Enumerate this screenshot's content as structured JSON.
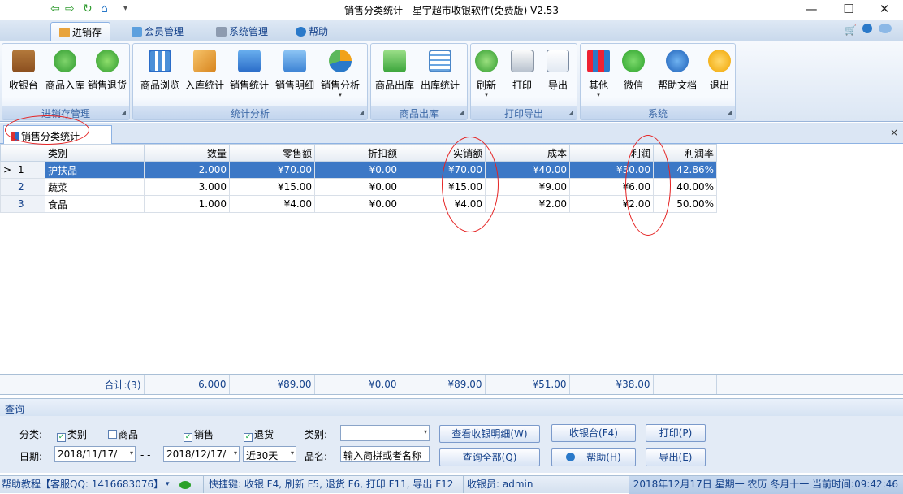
{
  "window": {
    "title": "销售分类统计 - 星宇超市收银软件(免费版) V2.53",
    "controls": {
      "minimize": "—",
      "maximize": "☐",
      "close": "✕"
    }
  },
  "ribbon_tabs": [
    "进销存",
    "会员管理",
    "系统管理",
    "帮助"
  ],
  "ribbon_groups": [
    {
      "label": "进销存管理",
      "buttons": [
        "收银台",
        "商品入库",
        "销售退货"
      ]
    },
    {
      "label": "统计分析",
      "buttons": [
        "商品浏览",
        "入库统计",
        "销售统计",
        "销售明细",
        "销售分析"
      ]
    },
    {
      "label": "商品出库",
      "buttons": [
        "商品出库",
        "出库统计"
      ]
    },
    {
      "label": "打印导出",
      "buttons": [
        "刷新",
        "打印",
        "导出"
      ]
    },
    {
      "label": "系统",
      "buttons": [
        "其他",
        "微信",
        "帮助文档",
        "退出"
      ]
    }
  ],
  "doc_tab": {
    "label": "销售分类统计",
    "close": "×"
  },
  "grid": {
    "columns": [
      "类别",
      "数量",
      "零售额",
      "折扣额",
      "实销额",
      "成本",
      "利润",
      "利润率"
    ],
    "rows": [
      {
        "idx": "1",
        "marker": ">",
        "cells": [
          "护扶品",
          "2.000",
          "¥70.00",
          "¥0.00",
          "¥70.00",
          "¥40.00",
          "¥30.00",
          "42.86%"
        ]
      },
      {
        "idx": "2",
        "marker": "",
        "cells": [
          "蔬菜",
          "3.000",
          "¥15.00",
          "¥0.00",
          "¥15.00",
          "¥9.00",
          "¥6.00",
          "40.00%"
        ]
      },
      {
        "idx": "3",
        "marker": "",
        "cells": [
          "食品",
          "1.000",
          "¥4.00",
          "¥0.00",
          "¥4.00",
          "¥2.00",
          "¥2.00",
          "50.00%"
        ]
      }
    ],
    "footer": [
      "合计:(3)",
      "6.000",
      "¥89.00",
      "¥0.00",
      "¥89.00",
      "¥51.00",
      "¥38.00",
      ""
    ]
  },
  "query": {
    "header": "查询",
    "category_label": "分类:",
    "cb_category": "类别",
    "cb_product": "商品",
    "cb_sales": "销售",
    "cb_return": "退货",
    "type_label": "类别:",
    "type_value": "",
    "date_label": "日期:",
    "date_from": "2018/11/17/",
    "date_sep": "- -",
    "date_to": "2018/12/17/",
    "range_value": "近30天",
    "name_label": "品名:",
    "name_placeholder": "输入简拼或者名称",
    "buttons": {
      "detail": "查看收银明细(W)",
      "cashier": "收银台(F4)",
      "print": "打印(P)",
      "query_all": "查询全部(Q)",
      "help": "帮助(H)",
      "export": "导出(E)"
    }
  },
  "status": {
    "help": "帮助教程【客服QQ: 1416683076】",
    "shortcuts": "快捷键: 收银 F4, 刷新 F5, 退货 F6, 打印 F11, 导出 F12",
    "cashier": "收银员: admin",
    "datetime": "2018年12月17日 星期一 农历 冬月十一 当前时间:09:42:46"
  },
  "colors": {
    "selected_row": "#3c78c6",
    "annotation": "#e52222",
    "ribbon_text": "#15428b"
  }
}
